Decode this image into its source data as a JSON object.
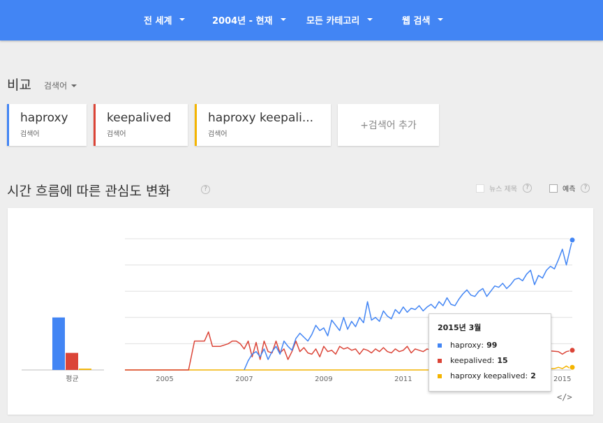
{
  "filters": [
    {
      "label": "전 세계"
    },
    {
      "label": "2004년 - 현재"
    },
    {
      "label": "모든 카테고리"
    },
    {
      "label": "웹 검색"
    }
  ],
  "compare": {
    "title": "비교",
    "mode": "검색어"
  },
  "terms": [
    {
      "name": "haproxy",
      "sub": "검색어",
      "color": "#4285f4"
    },
    {
      "name": "keepalived",
      "sub": "검색어",
      "color": "#db4437"
    },
    {
      "name": "haproxy keepali...",
      "sub": "검색어",
      "color": "#f4b400"
    }
  ],
  "add_term": "+검색어 추가",
  "section": {
    "title": "시간 흐름에 따른 관심도 변화",
    "help": "?"
  },
  "options": {
    "news": "뉴스 제목",
    "forecast": "예측",
    "help": "?"
  },
  "tooltip": {
    "title": "2015년 3월",
    "rows": [
      {
        "name": "haproxy",
        "value": "99"
      },
      {
        "name": "keepalived",
        "value": "15"
      },
      {
        "name": "haproxy keepalived",
        "value": "2"
      }
    ]
  },
  "embed_label": "</>",
  "chart_data": {
    "type": "line",
    "x_range": [
      2004.0,
      2015.25
    ],
    "ylim": [
      0,
      100
    ],
    "xticks": [
      "2005",
      "2007",
      "2009",
      "2011",
      "2013",
      "2015"
    ],
    "average_label": "평균",
    "averages": [
      {
        "name": "haproxy",
        "value": 40
      },
      {
        "name": "keepalived",
        "value": 13
      },
      {
        "name": "haproxy keepalived",
        "value": 1
      }
    ],
    "series": [
      {
        "name": "haproxy",
        "color": "#4285f4",
        "points": [
          [
            2007.0,
            0
          ],
          [
            2007.1,
            7
          ],
          [
            2007.2,
            12
          ],
          [
            2007.3,
            14
          ],
          [
            2007.4,
            10
          ],
          [
            2007.5,
            16
          ],
          [
            2007.6,
            8
          ],
          [
            2007.7,
            14
          ],
          [
            2007.8,
            18
          ],
          [
            2007.9,
            12
          ],
          [
            2008.0,
            22
          ],
          [
            2008.1,
            18
          ],
          [
            2008.2,
            15
          ],
          [
            2008.3,
            24
          ],
          [
            2008.4,
            28
          ],
          [
            2008.5,
            25
          ],
          [
            2008.6,
            22
          ],
          [
            2008.7,
            27
          ],
          [
            2008.8,
            34
          ],
          [
            2008.9,
            30
          ],
          [
            2009.0,
            32
          ],
          [
            2009.1,
            26
          ],
          [
            2009.2,
            38
          ],
          [
            2009.3,
            34
          ],
          [
            2009.4,
            30
          ],
          [
            2009.5,
            40
          ],
          [
            2009.6,
            31
          ],
          [
            2009.7,
            37
          ],
          [
            2009.8,
            33
          ],
          [
            2009.9,
            40
          ],
          [
            2010.0,
            36
          ],
          [
            2010.1,
            52
          ],
          [
            2010.2,
            38
          ],
          [
            2010.3,
            40
          ],
          [
            2010.4,
            37
          ],
          [
            2010.5,
            45
          ],
          [
            2010.6,
            41
          ],
          [
            2010.7,
            39
          ],
          [
            2010.8,
            46
          ],
          [
            2010.9,
            43
          ],
          [
            2011.0,
            48
          ],
          [
            2011.1,
            44
          ],
          [
            2011.2,
            47
          ],
          [
            2011.3,
            46
          ],
          [
            2011.4,
            49
          ],
          [
            2011.5,
            45
          ],
          [
            2011.6,
            48
          ],
          [
            2011.7,
            50
          ],
          [
            2011.8,
            47
          ],
          [
            2011.9,
            52
          ],
          [
            2012.0,
            49
          ],
          [
            2012.1,
            55
          ],
          [
            2012.2,
            50
          ],
          [
            2012.3,
            49
          ],
          [
            2012.4,
            54
          ],
          [
            2012.5,
            58
          ],
          [
            2012.6,
            61
          ],
          [
            2012.7,
            57
          ],
          [
            2012.8,
            56
          ],
          [
            2012.9,
            60
          ],
          [
            2013.0,
            62
          ],
          [
            2013.1,
            56
          ],
          [
            2013.2,
            60
          ],
          [
            2013.3,
            64
          ],
          [
            2013.4,
            63
          ],
          [
            2013.5,
            66
          ],
          [
            2013.6,
            62
          ],
          [
            2013.7,
            65
          ],
          [
            2013.8,
            69
          ],
          [
            2013.9,
            70
          ],
          [
            2014.0,
            68
          ],
          [
            2014.1,
            73
          ],
          [
            2014.2,
            76
          ],
          [
            2014.3,
            65
          ],
          [
            2014.4,
            72
          ],
          [
            2014.5,
            70
          ],
          [
            2014.6,
            76
          ],
          [
            2014.7,
            79
          ],
          [
            2014.8,
            77
          ],
          [
            2014.9,
            84
          ],
          [
            2015.0,
            92
          ],
          [
            2015.1,
            80
          ],
          [
            2015.2,
            93
          ],
          [
            2015.25,
            99
          ]
        ]
      },
      {
        "name": "keepalived",
        "color": "#db4437",
        "points": [
          [
            2004.0,
            0
          ],
          [
            2005.1,
            0
          ],
          [
            2005.6,
            0
          ],
          [
            2005.75,
            22
          ],
          [
            2006.0,
            22
          ],
          [
            2006.1,
            29
          ],
          [
            2006.2,
            18
          ],
          [
            2006.4,
            18
          ],
          [
            2006.6,
            20
          ],
          [
            2006.7,
            22
          ],
          [
            2006.8,
            22
          ],
          [
            2006.9,
            20
          ],
          [
            2007.0,
            16
          ],
          [
            2007.1,
            22
          ],
          [
            2007.2,
            10
          ],
          [
            2007.3,
            21
          ],
          [
            2007.4,
            8
          ],
          [
            2007.5,
            22
          ],
          [
            2007.6,
            14
          ],
          [
            2007.7,
            13
          ],
          [
            2007.8,
            22
          ],
          [
            2007.9,
            13
          ],
          [
            2008.0,
            16
          ],
          [
            2008.1,
            8
          ],
          [
            2008.2,
            14
          ],
          [
            2008.3,
            22
          ],
          [
            2008.4,
            14
          ],
          [
            2008.5,
            17
          ],
          [
            2008.6,
            13
          ],
          [
            2008.7,
            12
          ],
          [
            2008.8,
            16
          ],
          [
            2008.9,
            10
          ],
          [
            2009.0,
            18
          ],
          [
            2009.1,
            14
          ],
          [
            2009.2,
            15
          ],
          [
            2009.3,
            12
          ],
          [
            2009.4,
            18
          ],
          [
            2009.5,
            16
          ],
          [
            2009.6,
            17
          ],
          [
            2009.7,
            15
          ],
          [
            2009.8,
            16
          ],
          [
            2009.9,
            12
          ],
          [
            2010.0,
            16
          ],
          [
            2010.1,
            15
          ],
          [
            2010.2,
            13
          ],
          [
            2010.3,
            16
          ],
          [
            2010.4,
            14
          ],
          [
            2010.5,
            17
          ],
          [
            2010.6,
            14
          ],
          [
            2010.7,
            13
          ],
          [
            2010.8,
            16
          ],
          [
            2010.9,
            14
          ],
          [
            2011.0,
            15
          ],
          [
            2011.1,
            18
          ],
          [
            2011.2,
            13
          ],
          [
            2011.3,
            16
          ],
          [
            2011.4,
            15
          ],
          [
            2011.5,
            14
          ],
          [
            2011.6,
            16
          ],
          [
            2011.7,
            15
          ],
          [
            2011.8,
            13
          ],
          [
            2011.9,
            15
          ],
          [
            2012.0,
            16
          ],
          [
            2012.5,
            15
          ],
          [
            2013.0,
            15
          ],
          [
            2013.5,
            15
          ],
          [
            2014.0,
            15
          ],
          [
            2014.5,
            15
          ],
          [
            2014.9,
            14
          ],
          [
            2015.0,
            12
          ],
          [
            2015.1,
            14
          ],
          [
            2015.25,
            15
          ]
        ]
      },
      {
        "name": "haproxy keepalived",
        "color": "#f4b400",
        "points": [
          [
            2004.0,
            0
          ],
          [
            2005.0,
            0
          ],
          [
            2006.0,
            0
          ],
          [
            2007.0,
            0
          ],
          [
            2008.0,
            0
          ],
          [
            2009.0,
            0
          ],
          [
            2010.0,
            0
          ],
          [
            2011.0,
            0
          ],
          [
            2012.0,
            0
          ],
          [
            2013.0,
            0
          ],
          [
            2014.0,
            0
          ],
          [
            2014.5,
            1
          ],
          [
            2014.8,
            1
          ],
          [
            2014.9,
            2
          ],
          [
            2015.0,
            1
          ],
          [
            2015.1,
            3
          ],
          [
            2015.2,
            1
          ],
          [
            2015.25,
            2
          ]
        ]
      }
    ]
  }
}
